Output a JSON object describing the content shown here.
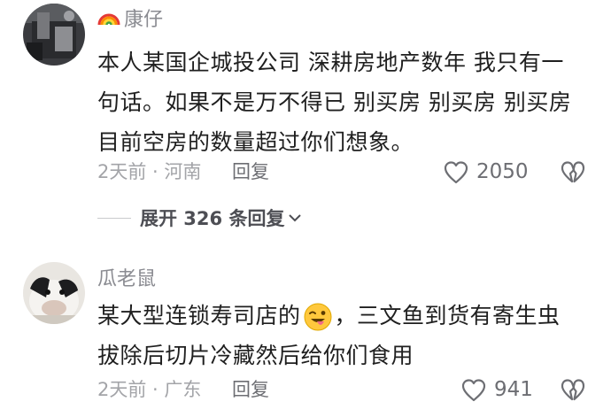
{
  "comments": [
    {
      "username": "康仔",
      "username_emoji": "rainbow-icon",
      "lines": [
        "本人某国企城投公司 深耕房地产数年 我只有一",
        "句话。如果不是万不得已 别买房 别买房 别买房",
        "目前空房的数量超过你们想象。"
      ],
      "meta": "2天前 · 河南",
      "reply_label": "回复",
      "like_count": "2050",
      "expand_label": "展开 326 条回复"
    },
    {
      "username": "瓜老鼠",
      "line1_before_emoji": "某大型连锁寿司店的",
      "inline_emoji": "winking-tongue-emoji",
      "line1_after_emoji": "，三文鱼到货有寄生虫",
      "line2": "拔除后切片冷藏然后给你们食用",
      "meta": "2天前 · 广东",
      "reply_label": "回复",
      "like_count": "941"
    }
  ],
  "colors": {
    "primary_text": "#1f1f1f",
    "secondary_text": "#8a8b91",
    "meta_text": "#a3a4a8",
    "icon": "#6d6e73"
  }
}
